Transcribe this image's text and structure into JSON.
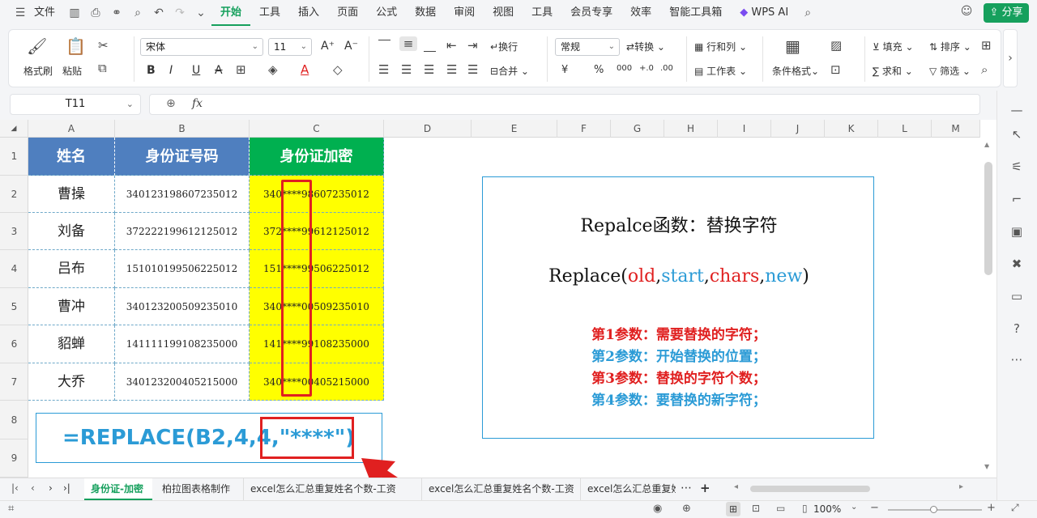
{
  "menu": {
    "hamburger": "☰",
    "file": "文件",
    "items": [
      "开始",
      "工具",
      "插入",
      "页面",
      "公式",
      "数据",
      "审阅",
      "视图",
      "工具",
      "会员专享",
      "效率",
      "智能工具箱"
    ],
    "wps_ai": "WPS AI",
    "share": "分享"
  },
  "ribbon": {
    "format_painter": "格式刷",
    "paste": "粘贴",
    "font_name": "宋体",
    "font_size": "11",
    "number_format": "常规",
    "wrap": "换行",
    "merge": "合并",
    "convert": "转换",
    "row_col": "行和列",
    "worksheet": "工作表",
    "cond_format": "条件格式",
    "fill": "填充",
    "sort": "排序",
    "sum": "求和",
    "filter": "筛选",
    "bold": "B",
    "italic": "I",
    "underline": "U",
    "strike": "A",
    "currency": "¥",
    "percent": "%",
    "font_grow": "A⁺",
    "font_shrink": "A⁻"
  },
  "formula_bar": {
    "name_box": "T11",
    "fx": "fx",
    "value": ""
  },
  "columns": [
    "A",
    "B",
    "C",
    "D",
    "E",
    "F",
    "G",
    "H",
    "I",
    "J",
    "K",
    "L",
    "M"
  ],
  "rows": [
    "1",
    "2",
    "3",
    "4",
    "5",
    "6",
    "7",
    "8",
    "9"
  ],
  "table": {
    "headers": [
      "姓名",
      "身份证号码",
      "身份证加密"
    ],
    "rows": [
      {
        "name": "曹操",
        "id": "340123198607235012",
        "masked": "340****98607235012"
      },
      {
        "name": "刘备",
        "id": "372222199612125012",
        "masked": "372****99612125012"
      },
      {
        "name": "吕布",
        "id": "151010199506225012",
        "masked": "151****99506225012"
      },
      {
        "name": "曹冲",
        "id": "340123200509235010",
        "masked": "340****00509235010"
      },
      {
        "name": "貂蝉",
        "id": "141111199108235000",
        "masked": "141****99108235000"
      },
      {
        "name": "大乔",
        "id": "340123200405215000",
        "masked": "340****00405215000"
      }
    ]
  },
  "formula_demo": {
    "prefix": "=REPLACE(B2,4,4,",
    "highlight": "\"****\"",
    "suffix": ")"
  },
  "info": {
    "title": "Repalce函数：替换字符",
    "syntax_prefix": "Replace(",
    "p1": "old",
    "comma": ",",
    "p2": "start",
    "p3": "chars",
    "p4": "new",
    "syntax_suffix": ")",
    "lines": [
      "第1参数：需要替换的字符；",
      "第2参数：开始替换的位置；",
      "第3参数：替换的字符个数；",
      "第4参数：要替换的新字符；"
    ]
  },
  "sheet_tabs": [
    "身份证-加密",
    "柏拉图表格制作",
    "excel怎么汇总重复姓名个数-工资",
    "excel怎么汇总重复姓名个数-工资",
    "excel怎么汇总重复姓"
  ],
  "status": {
    "zoom": "100%"
  },
  "colors": {
    "header_blue": "#4f7fbf",
    "header_green": "#00b050",
    "yellow": "#ffff00",
    "accent": "#16a05d",
    "red": "#e02020",
    "blue": "#2b9bd6"
  }
}
